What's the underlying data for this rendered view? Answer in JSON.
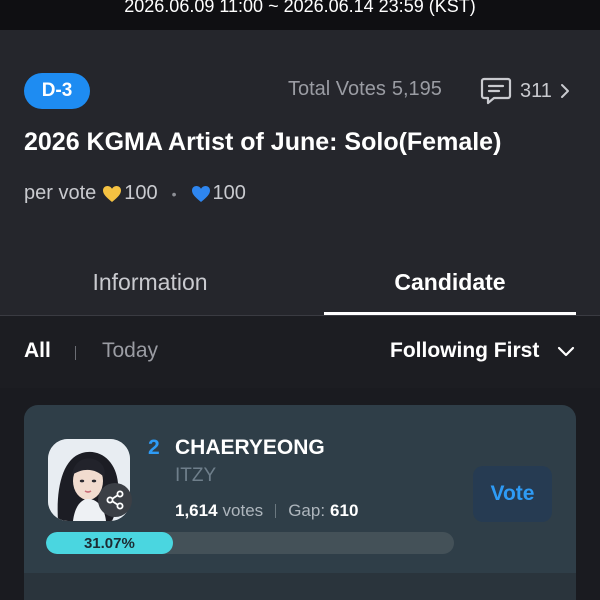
{
  "header": {
    "period": "2026.06.09 11:00 ~ 2026.06.14 23:59 (KST)"
  },
  "event": {
    "dday_badge": "D-3",
    "total_votes_label": "Total Votes",
    "total_votes_value": "5,195",
    "comment_count": "311",
    "title": "2026 KGMA Artist of June: Solo(Female)",
    "per_vote_label": "per vote",
    "per_vote_gold": "100",
    "per_vote_separator": "•",
    "per_vote_blue": "100"
  },
  "tabs": [
    {
      "label": "Information",
      "active": false
    },
    {
      "label": "Candidate",
      "active": true
    }
  ],
  "filters": {
    "all_label": "All",
    "today_label": "Today",
    "sort_label": "Following First"
  },
  "candidate": {
    "rank": "2",
    "name": "CHAERYEONG",
    "group": "ITZY",
    "votes_value": "1,614",
    "votes_unit": "votes",
    "gap_label": "Gap:",
    "gap_value": "610",
    "vote_button": "Vote",
    "percent_label": "31.07%",
    "percent_value": 31.07
  },
  "colors": {
    "accent_blue": "#1e8cf2",
    "progress_fill": "#4ad6e0",
    "heart_gold": "#f5c242",
    "heart_blue": "#2e86f0"
  },
  "icons": {
    "comment": "comment-bubble-icon",
    "chevron_right": "chevron-right-icon",
    "chevron_down": "chevron-down-icon",
    "share": "share-icon",
    "heart_gold": "gold-heart-icon",
    "heart_blue": "blue-heart-icon"
  }
}
